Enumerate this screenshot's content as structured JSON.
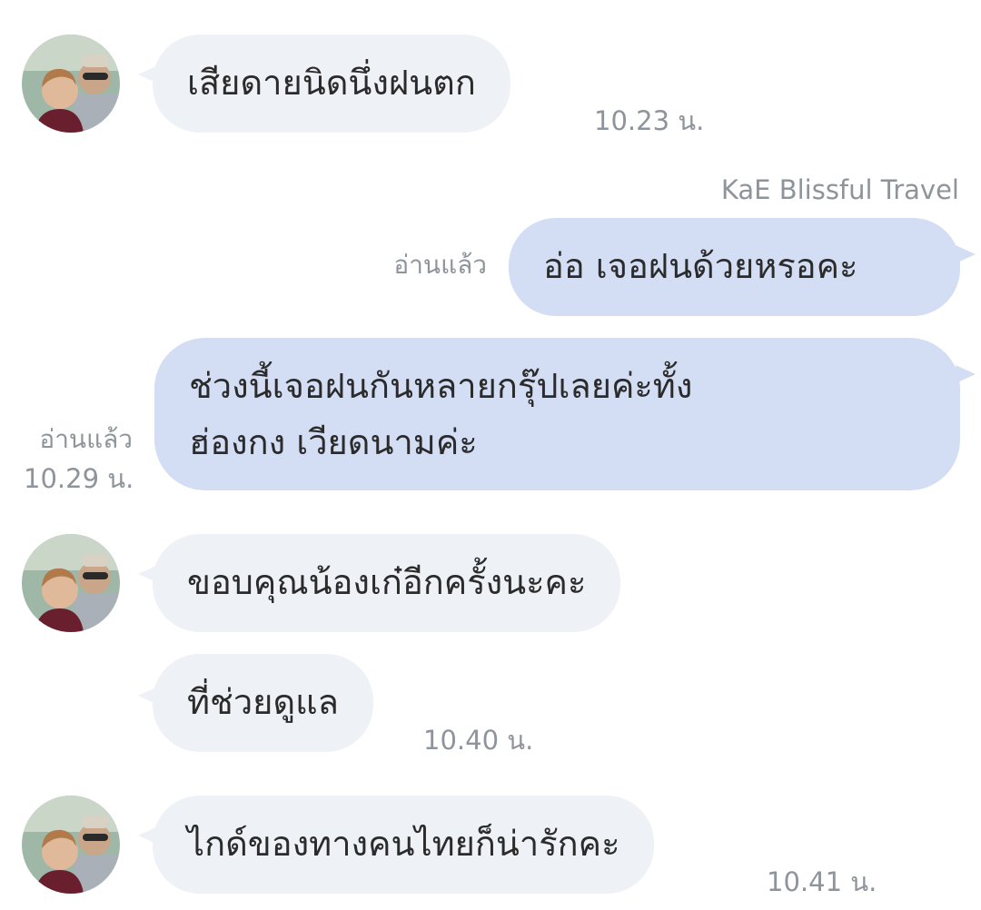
{
  "chat": {
    "messages": [
      {
        "side": "in",
        "text": "เสียดายนิดนึ่งฝนตก",
        "time": "10.23 น."
      },
      {
        "side": "out",
        "sender": "KaE Blissful Travel",
        "text": "อ่อ เจอฝนด้วยหรอคะ",
        "read": "อ่านแล้ว"
      },
      {
        "side": "out",
        "text_line1": "ช่วงนี้เจอฝนกันหลายกรุ๊ปเลยค่ะทั้ง",
        "text_line2": "ฮ่องกง เวียดนามค่ะ",
        "read": "อ่านแล้ว",
        "time": "10.29 น."
      },
      {
        "side": "in",
        "text": "ขอบคุณน้องเก๋อีกครั้งนะคะ"
      },
      {
        "side": "in",
        "text": "ที่ช่วยดูแล",
        "time": "10.40 น."
      },
      {
        "side": "in",
        "text": "ไกด์ของทางคนไทยก็น่ารักคะ",
        "time": "10.41 น."
      }
    ]
  },
  "colors": {
    "incoming_bubble": "#eef1f5",
    "outgoing_bubble": "#d3ddf3",
    "meta_text": "#8e949b",
    "message_text": "#2b2b2b"
  }
}
